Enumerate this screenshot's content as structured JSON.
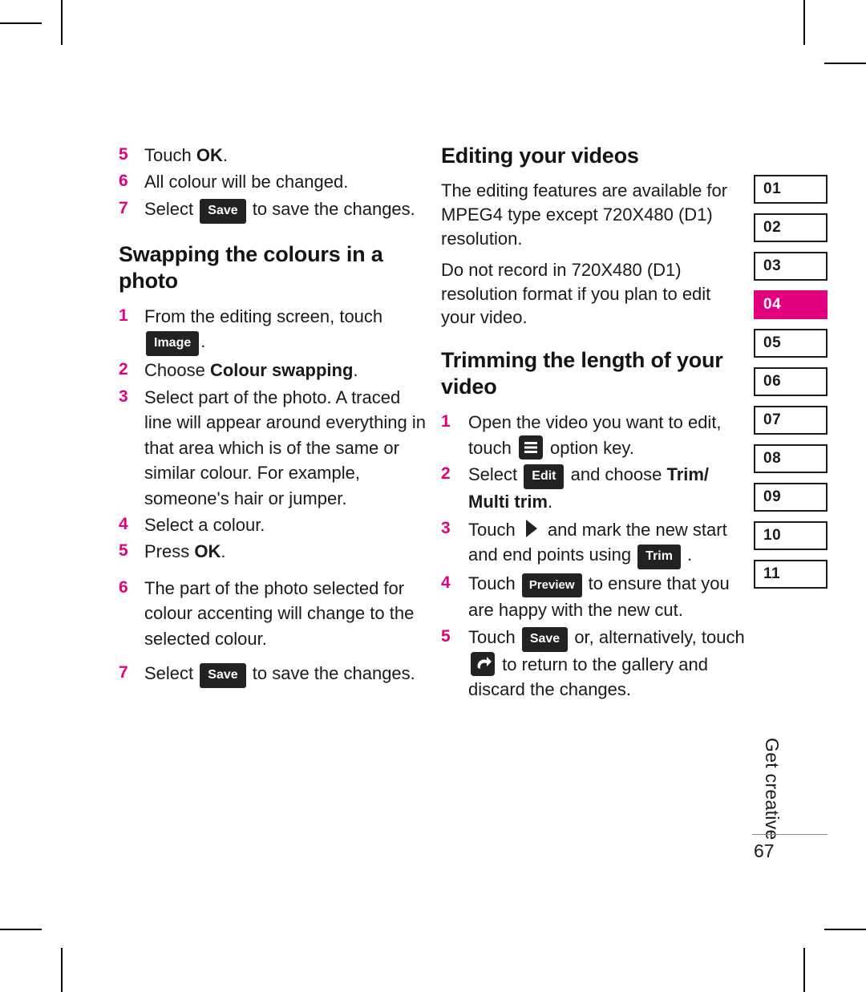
{
  "page": {
    "folio": "67",
    "running_head": "Get creative"
  },
  "rail": {
    "tabs": [
      {
        "label": "01",
        "active": false
      },
      {
        "label": "02",
        "active": false
      },
      {
        "label": "03",
        "active": false
      },
      {
        "label": "04",
        "active": true
      },
      {
        "label": "05",
        "active": false
      },
      {
        "label": "06",
        "active": false
      },
      {
        "label": "07",
        "active": false
      },
      {
        "label": "08",
        "active": false
      },
      {
        "label": "09",
        "active": false
      },
      {
        "label": "10",
        "active": false
      },
      {
        "label": "11",
        "active": false
      }
    ],
    "accent_color": "#e3007f"
  },
  "left_column": {
    "continued_steps": [
      {
        "num": "5",
        "pre": "Touch ",
        "bold": "OK",
        "post": "."
      },
      {
        "num": "6",
        "pre": "All colour will be changed.",
        "bold": "",
        "post": ""
      },
      {
        "num": "7",
        "pre": "Select ",
        "chip": "Save",
        "post": " to save the changes."
      }
    ],
    "heading": "Swapping the colours in a photo",
    "steps": [
      {
        "num": "1",
        "text": "From the editing screen, touch",
        "chip": "Image",
        "chip_after": "."
      },
      {
        "num": "2",
        "pre": "Choose ",
        "bold": "Colour swapping",
        "post": "."
      },
      {
        "num": "3",
        "text": "Select part of the photo. A traced line will appear around everything in that area which is of the same or similar colour. For example, someone's hair or jumper."
      },
      {
        "num": "4",
        "text": "Select a colour."
      },
      {
        "num": "5",
        "pre": "Press ",
        "bold": "OK",
        "post": "."
      },
      {
        "num": "6",
        "text": "The part of the photo selected for colour accenting will change to the selected colour."
      },
      {
        "num": "7",
        "pre": "Select ",
        "chip": "Save",
        "post": " to save the changes."
      }
    ]
  },
  "right_column": {
    "heading_1": "Editing your videos",
    "paragraph_1": "The editing features are available for MPEG4 type except 720X480 (D1) resolution.",
    "paragraph_2": "Do not record in 720X480 (D1) resolution format if you plan to edit your video.",
    "heading_2": "Trimming the length of your video",
    "steps": [
      {
        "num": "1",
        "pre": "Open the video you want to edit, touch ",
        "icon": "menu-option-key",
        "post": " option key."
      },
      {
        "num": "2",
        "pre": "Select ",
        "chip": "Edit",
        "mid": " and choose ",
        "bold": "Trim/ Multi trim",
        "post": "."
      },
      {
        "num": "3",
        "pre": "Touch ",
        "icon": "play-marker",
        "mid": " and mark the new start and end points using ",
        "chip": "Trim",
        "post": " ."
      },
      {
        "num": "4",
        "pre": "Touch ",
        "chip": "Preview",
        "post": " to ensure that you are happy with the new cut."
      },
      {
        "num": "5",
        "pre": "Touch ",
        "chip": "Save",
        "mid": " or, alternatively, touch ",
        "icon": "back-arrow",
        "post": " to return to the gallery and discard the changes."
      }
    ]
  }
}
